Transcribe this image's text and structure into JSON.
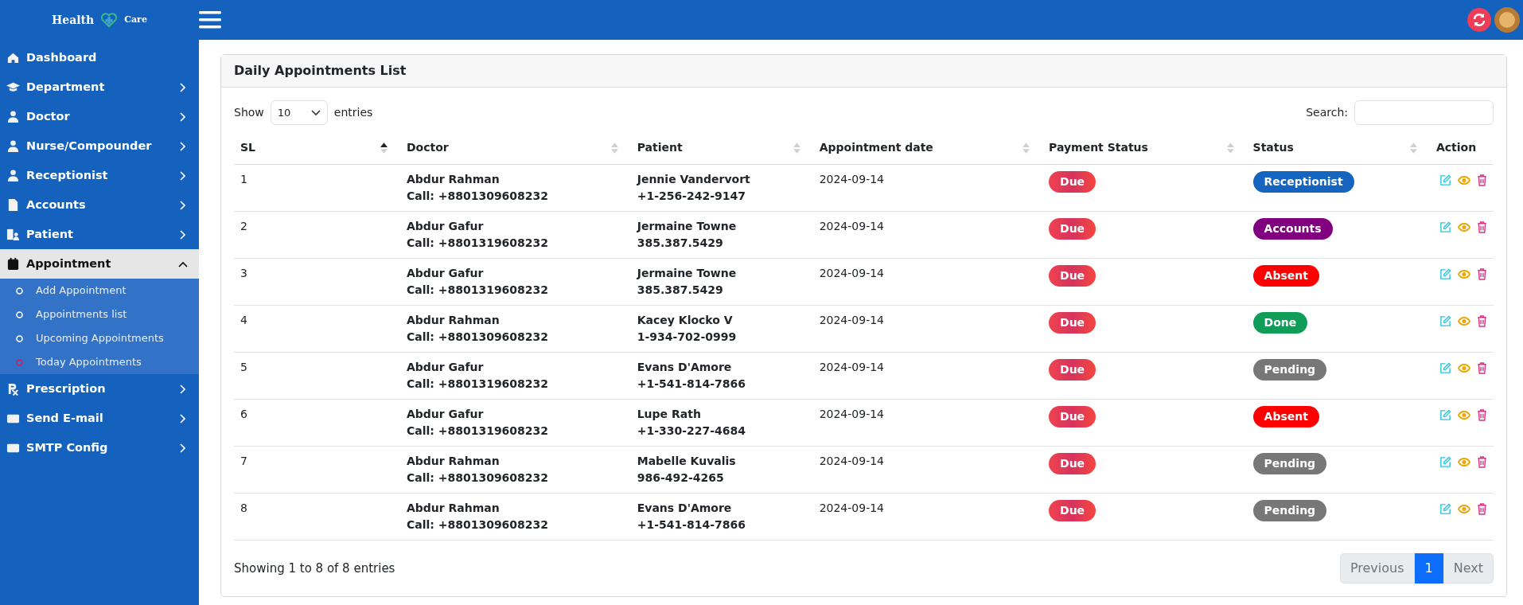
{
  "brand": {
    "left": "Health",
    "right": "Care"
  },
  "sidebar": {
    "items": [
      {
        "label": "Dashboard",
        "has_submenu": false,
        "selected": false
      },
      {
        "label": "Department",
        "has_submenu": true,
        "expanded": false,
        "selected": false
      },
      {
        "label": "Doctor",
        "has_submenu": true,
        "expanded": false,
        "selected": false
      },
      {
        "label": "Nurse/Compounder",
        "has_submenu": true,
        "expanded": false,
        "selected": false
      },
      {
        "label": "Receptionist",
        "has_submenu": true,
        "expanded": false,
        "selected": false
      },
      {
        "label": "Accounts",
        "has_submenu": true,
        "expanded": false,
        "selected": false
      },
      {
        "label": "Patient",
        "has_submenu": true,
        "expanded": false,
        "selected": false
      },
      {
        "label": "Appointment",
        "has_submenu": true,
        "expanded": true,
        "selected": true,
        "children": [
          {
            "label": "Add Appointment",
            "selected": false
          },
          {
            "label": "Appointments list",
            "selected": false
          },
          {
            "label": "Upcoming Appointments",
            "selected": false
          },
          {
            "label": "Today Appointments",
            "selected": true
          }
        ]
      },
      {
        "label": "Prescription",
        "has_submenu": true,
        "expanded": false,
        "selected": false
      },
      {
        "label": "Send E-mail",
        "has_submenu": true,
        "expanded": false,
        "selected": false
      },
      {
        "label": "SMTP Config",
        "has_submenu": true,
        "expanded": false,
        "selected": false
      }
    ]
  },
  "card": {
    "title": "Daily Appointments List",
    "length": {
      "before": "Show",
      "value": "10",
      "after": "entries"
    },
    "search": {
      "label": "Search:"
    },
    "table": {
      "columns": [
        {
          "label": "SL",
          "sortable": true,
          "sorted": true
        },
        {
          "label": "Doctor",
          "sortable": true,
          "sorted": false
        },
        {
          "label": "Patient",
          "sortable": true,
          "sorted": false
        },
        {
          "label": "Appointment date",
          "sortable": true,
          "sorted": false
        },
        {
          "label": "Payment Status",
          "sortable": true,
          "sorted": false
        },
        {
          "label": "Status",
          "sortable": true,
          "sorted": false
        },
        {
          "label": "Action",
          "sortable": false
        }
      ],
      "rows": [
        {
          "sl": "1",
          "doctor": "Abdur Rahman",
          "doctor_phone": "Call: +8801309608232",
          "patient": "Jennie Vandervort",
          "patient_phone": "+1-256-242-9147",
          "date": "2024-09-14",
          "payment": "Due",
          "status": {
            "label": "Receptionist",
            "color": "#1565c0"
          }
        },
        {
          "sl": "2",
          "doctor": "Abdur Gafur",
          "doctor_phone": "Call: +8801319608232",
          "patient": "Jermaine Towne",
          "patient_phone": "385.387.5429",
          "date": "2024-09-14",
          "payment": "Due",
          "status": {
            "label": "Accounts",
            "color": "#800080"
          }
        },
        {
          "sl": "3",
          "doctor": "Abdur Gafur",
          "doctor_phone": "Call: +8801319608232",
          "patient": "Jermaine Towne",
          "patient_phone": "385.387.5429",
          "date": "2024-09-14",
          "payment": "Due",
          "status": {
            "label": "Absent",
            "color": "#ff0000"
          }
        },
        {
          "sl": "4",
          "doctor": "Abdur Rahman",
          "doctor_phone": "Call: +8801309608232",
          "patient": "Kacey Klocko V",
          "patient_phone": "1-934-702-0999",
          "date": "2024-09-14",
          "payment": "Due",
          "status": {
            "label": "Done",
            "color": "#0f9d58"
          }
        },
        {
          "sl": "5",
          "doctor": "Abdur Gafur",
          "doctor_phone": "Call: +8801319608232",
          "patient": "Evans D'Amore",
          "patient_phone": "+1-541-814-7866",
          "date": "2024-09-14",
          "payment": "Due",
          "status": {
            "label": "Pending",
            "color": "#777777"
          }
        },
        {
          "sl": "6",
          "doctor": "Abdur Gafur",
          "doctor_phone": "Call: +8801319608232",
          "patient": "Lupe Rath",
          "patient_phone": "+1-330-227-4684",
          "date": "2024-09-14",
          "payment": "Due",
          "status": {
            "label": "Absent",
            "color": "#ff0000"
          }
        },
        {
          "sl": "7",
          "doctor": "Abdur Rahman",
          "doctor_phone": "Call: +8801309608232",
          "patient": "Mabelle Kuvalis",
          "patient_phone": "986-492-4265",
          "date": "2024-09-14",
          "payment": "Due",
          "status": {
            "label": "Pending",
            "color": "#777777"
          }
        },
        {
          "sl": "8",
          "doctor": "Abdur Rahman",
          "doctor_phone": "Call: +8801309608232",
          "patient": "Evans D'Amore",
          "patient_phone": "+1-541-814-7866",
          "date": "2024-09-14",
          "payment": "Due",
          "status": {
            "label": "Pending",
            "color": "#777777"
          }
        }
      ]
    },
    "info": "Showing 1 to 8 of 8 entries",
    "pagination": [
      {
        "label": "Previous",
        "selected": false
      },
      {
        "label": "1",
        "selected": true
      },
      {
        "label": "Next",
        "selected": false
      }
    ]
  }
}
